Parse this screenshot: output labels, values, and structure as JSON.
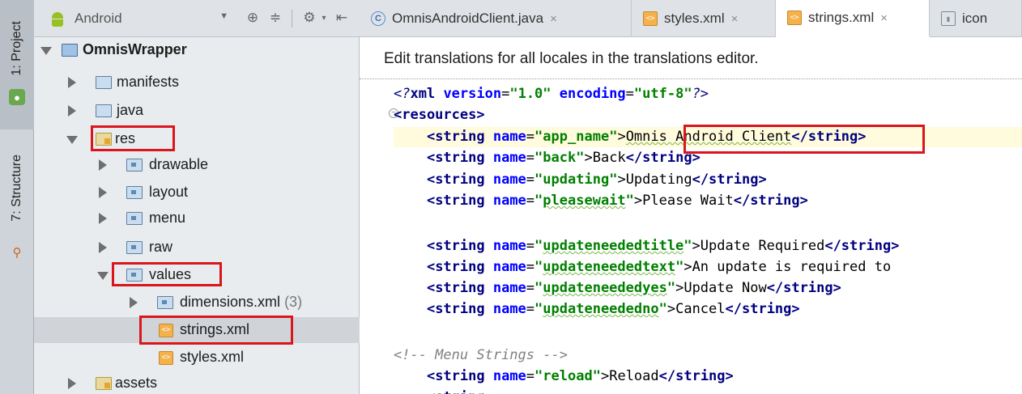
{
  "side_tabs": {
    "project": "1: Project",
    "structure": "7: Structure"
  },
  "project_panel": {
    "view_selector": "Android",
    "tree": [
      {
        "label": "OmnisWrapper",
        "count": ""
      },
      {
        "label": "manifests",
        "count": ""
      },
      {
        "label": "java",
        "count": ""
      },
      {
        "label": "res",
        "count": ""
      },
      {
        "label": "drawable",
        "count": ""
      },
      {
        "label": "layout",
        "count": ""
      },
      {
        "label": "menu",
        "count": ""
      },
      {
        "label": "raw",
        "count": ""
      },
      {
        "label": "values",
        "count": ""
      },
      {
        "label": "dimensions.xml",
        "count": "(3)"
      },
      {
        "label": "strings.xml",
        "count": ""
      },
      {
        "label": "styles.xml",
        "count": ""
      },
      {
        "label": "assets",
        "count": ""
      }
    ],
    "selected_item": "strings.xml"
  },
  "editor": {
    "tabs": [
      {
        "label": "OmnisAndroidClient.java",
        "icon": "C"
      },
      {
        "label": "styles.xml",
        "icon": "<>"
      },
      {
        "label": "strings.xml",
        "icon": "<>"
      },
      {
        "label": "icon",
        "icon": "img"
      }
    ],
    "active_tab": "strings.xml",
    "notice": "Edit translations for all locales in the translations editor.",
    "code": {
      "xml_decl": "<?xml version=\"1.0\" encoding=\"utf-8\"?>",
      "resources_open": "<resources>",
      "strings": [
        {
          "name": "app_name",
          "value": "Omnis Android Client"
        },
        {
          "name": "back",
          "value": "Back"
        },
        {
          "name": "updating",
          "value": "Updating"
        },
        {
          "name": "pleasewait",
          "value": "Please Wait"
        },
        {
          "name": "updateneededtitle",
          "value": "Update Required"
        },
        {
          "name": "updateneededtext",
          "value": "An update is required to"
        },
        {
          "name": "updateneededyes",
          "value": "Update Now"
        },
        {
          "name": "updateneededno",
          "value": "Cancel"
        },
        {
          "name": "reload",
          "value": "Reload"
        }
      ],
      "comment": "<!-- Menu Strings -->"
    }
  },
  "colors": {
    "highlight_box": "#d9161c",
    "caret_line": "#fffbdc",
    "xml_tag": "#000080",
    "xml_attr_value": "#008000",
    "xml_attr_name": "#0000ff"
  }
}
